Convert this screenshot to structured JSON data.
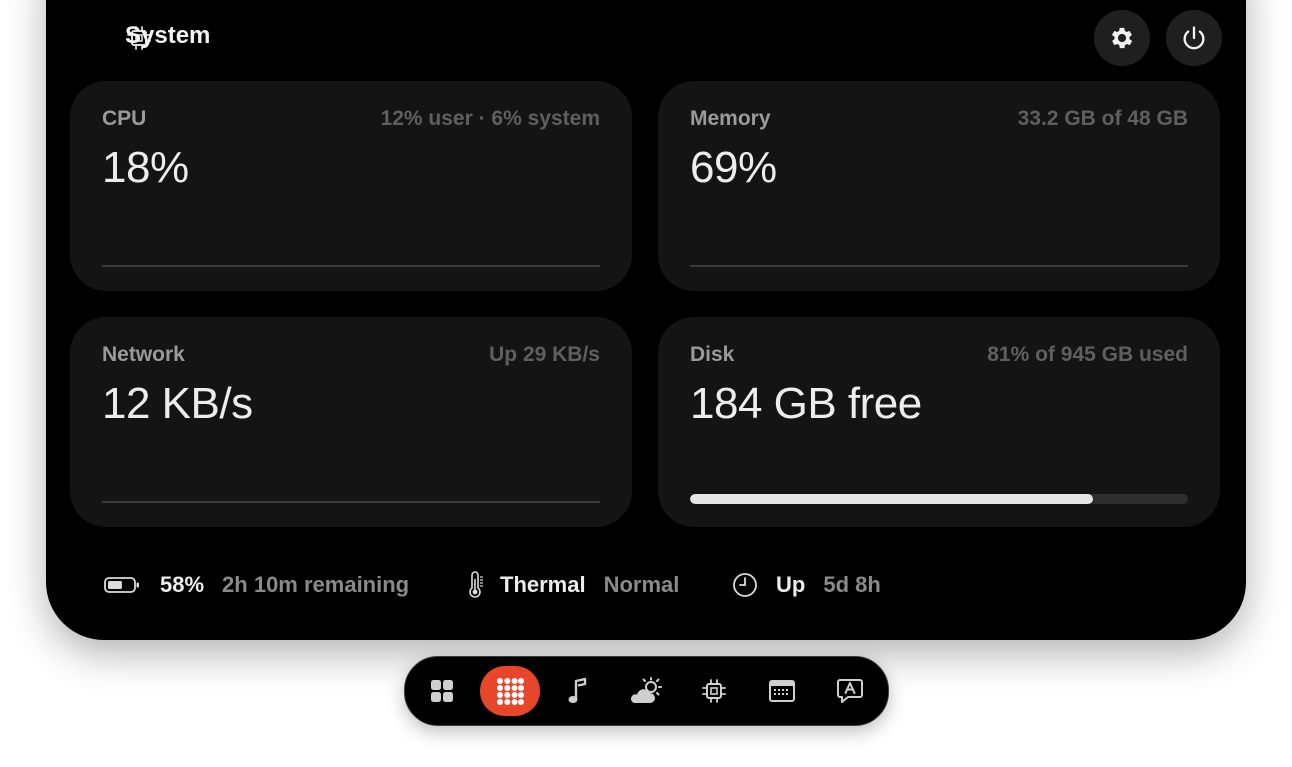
{
  "header": {
    "title": "System",
    "icon": "chip-icon"
  },
  "colors": {
    "accent": "#e8462a",
    "panel": "#000000",
    "card": "#141414"
  },
  "cards": {
    "cpu": {
      "label": "CPU",
      "meta": "12% user · 6% system",
      "value": "18%"
    },
    "memory": {
      "label": "Memory",
      "meta": "33.2 GB of 48 GB",
      "value": "69%"
    },
    "network": {
      "label": "Network",
      "meta": "Up 29 KB/s",
      "value": "12 KB/s"
    },
    "disk": {
      "label": "Disk",
      "meta": "81% of 945 GB used",
      "value": "184 GB free",
      "used_fraction": 0.81
    }
  },
  "status": {
    "battery": {
      "value": "58%",
      "detail": "2h 10m remaining",
      "level": 0.58
    },
    "thermal": {
      "label": "Thermal",
      "value": "Normal"
    },
    "uptime": {
      "label": "Up",
      "value": "5d 8h"
    }
  },
  "dock": {
    "items": [
      "grid-icon",
      "apps-icon",
      "music-icon",
      "weather-icon",
      "chip-icon",
      "keyboard-icon",
      "speech-bubble-icon"
    ],
    "active": "apps-icon"
  }
}
